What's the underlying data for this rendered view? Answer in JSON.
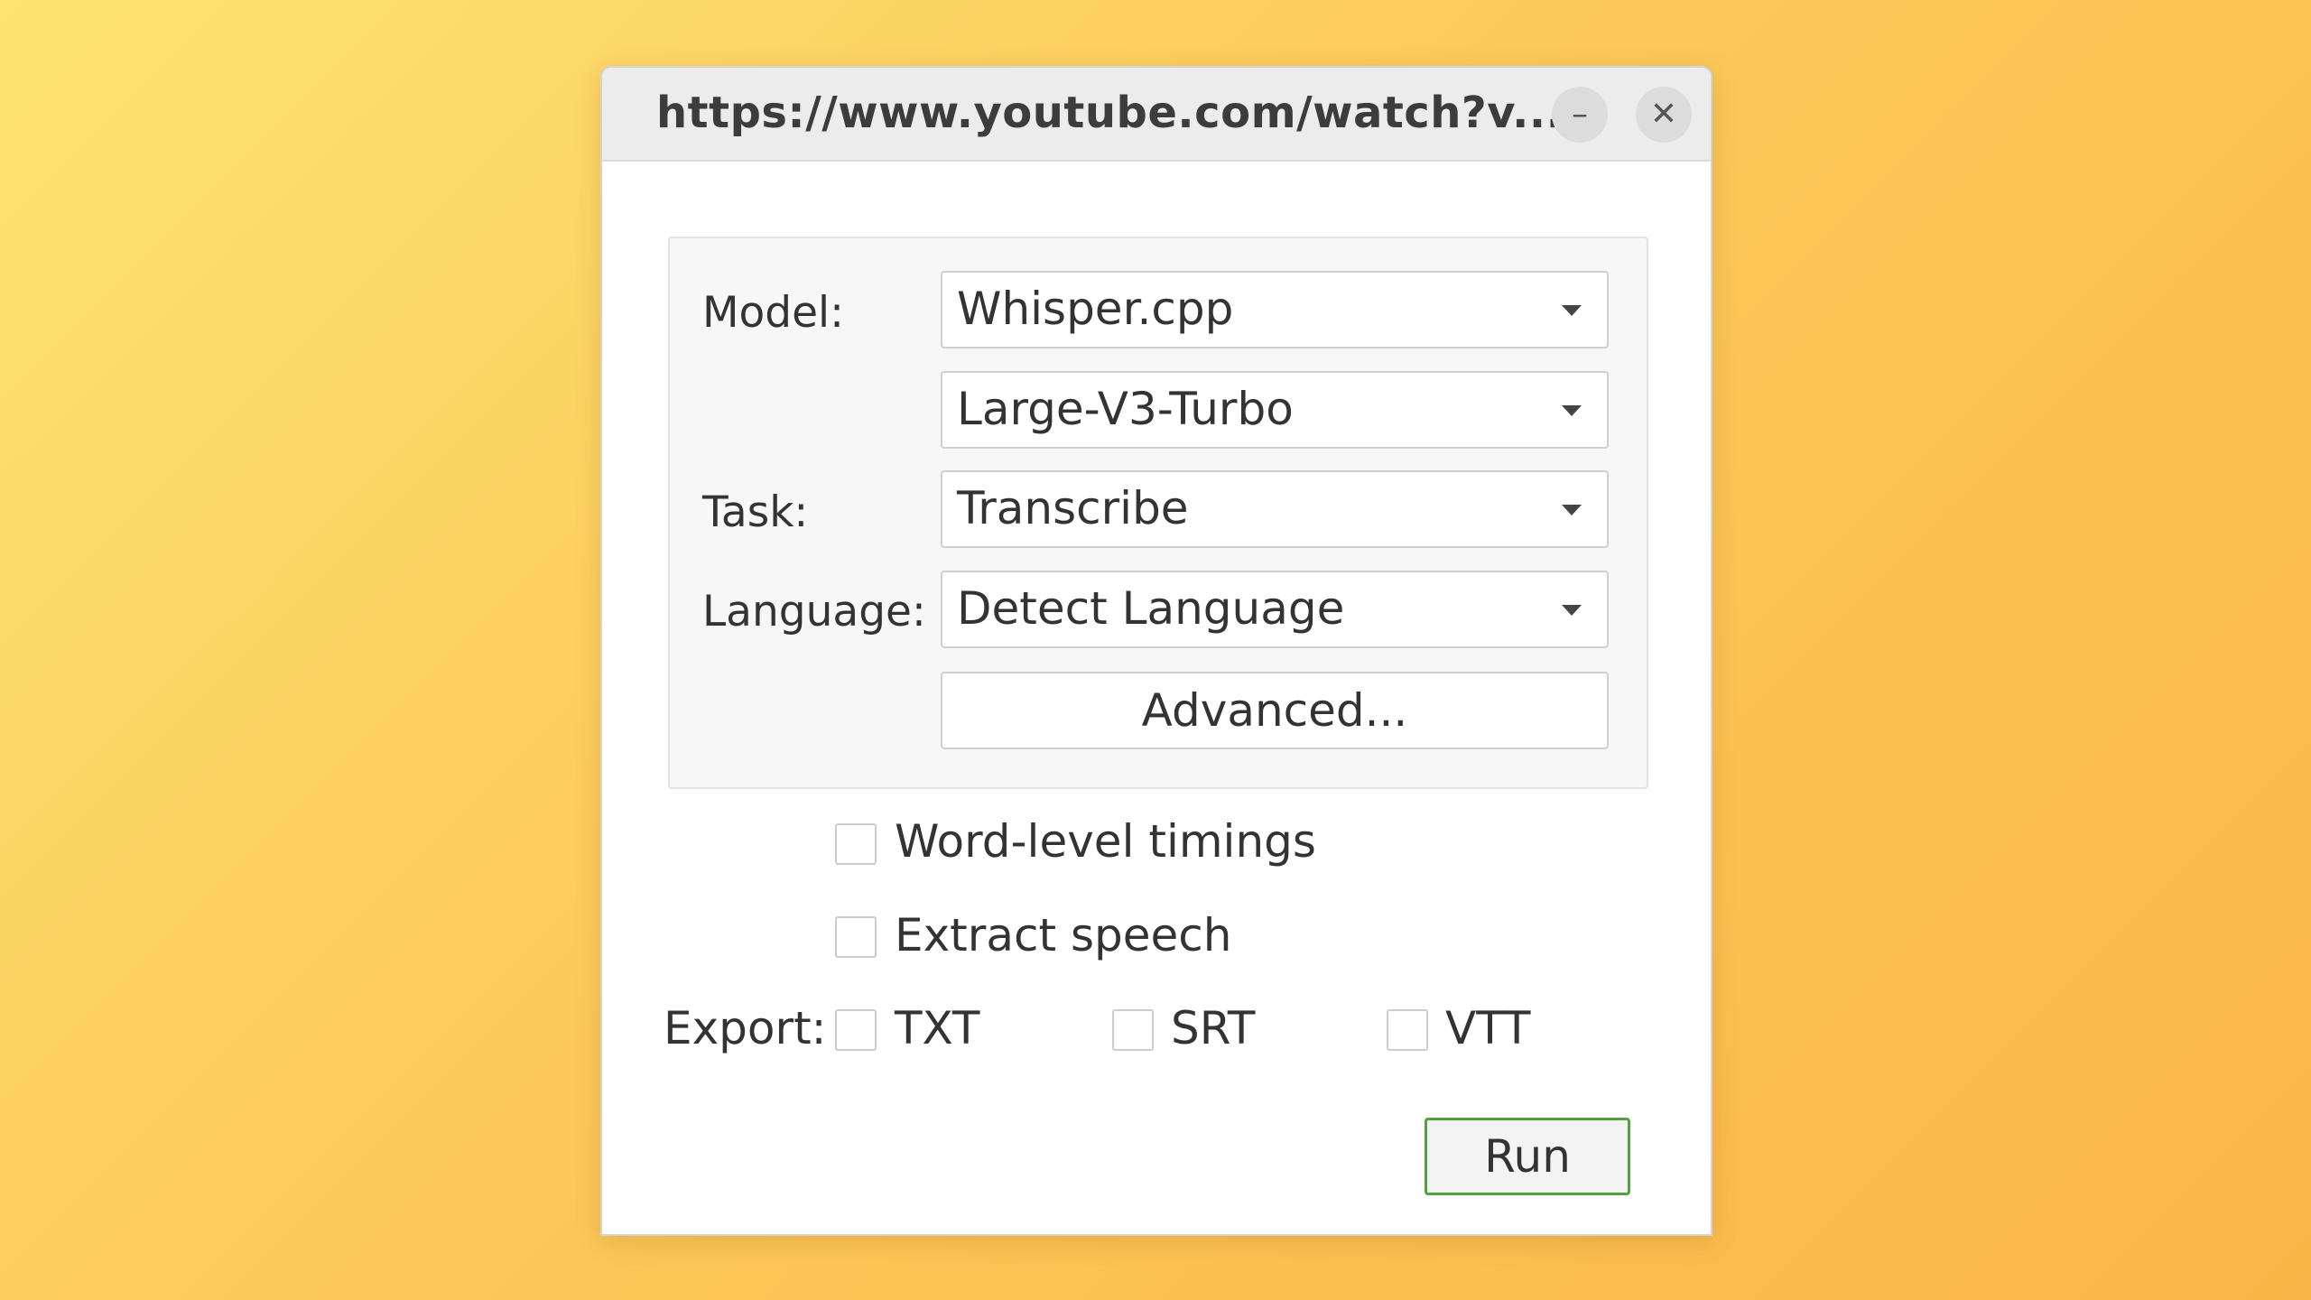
{
  "window": {
    "title": "https://www.youtube.com/watch?v...",
    "minimize_glyph": "–",
    "close_glyph": "✕"
  },
  "form": {
    "model_label": "Model:",
    "model_value": "Whisper.cpp",
    "model_size_value": "Large-V3-Turbo",
    "task_label": "Task:",
    "task_value": "Transcribe",
    "language_label": "Language:",
    "language_value": "Detect Language",
    "advanced_label": "Advanced..."
  },
  "options": {
    "word_level_timings": {
      "label": "Word-level timings",
      "checked": false
    },
    "extract_speech": {
      "label": "Extract speech",
      "checked": false
    }
  },
  "export": {
    "label": "Export:",
    "formats": [
      {
        "label": "TXT",
        "checked": false
      },
      {
        "label": "SRT",
        "checked": false
      },
      {
        "label": "VTT",
        "checked": false
      }
    ]
  },
  "actions": {
    "run_label": "Run"
  },
  "colors": {
    "run_border": "#4fa33a",
    "background_top": "#fde372",
    "background_bottom": "#fcb548"
  },
  "icons": [
    "minimize-icon",
    "close-icon",
    "chevron-down-icon"
  ]
}
